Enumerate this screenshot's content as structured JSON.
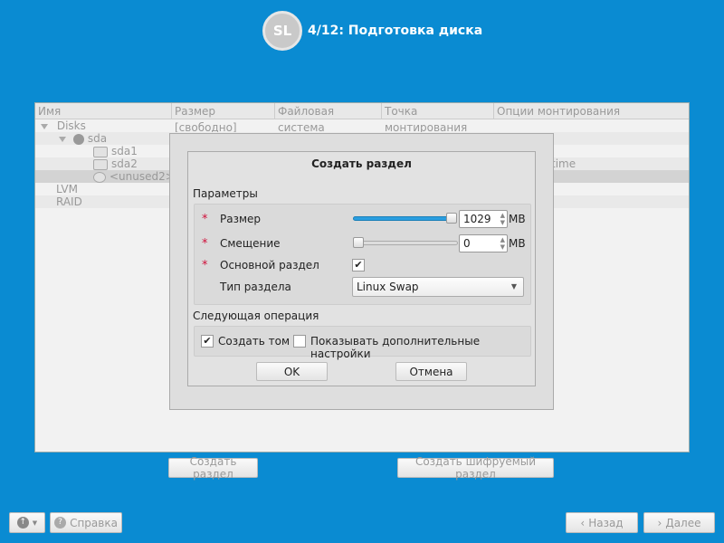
{
  "header": {
    "title": "4/12: Подготовка диска",
    "logo_text": "SL"
  },
  "table": {
    "columns": [
      "Имя",
      "Размер [свободно]",
      "Файловая система",
      "Точка монтирования",
      "Опции монтирования"
    ],
    "rows": {
      "disks": "Disks",
      "sda": "sda",
      "sda1": "sda1",
      "sda2": "sda2",
      "unused": "<unused2>",
      "lvm": "LVM",
      "raid": "RAID"
    },
    "partial_option": "time"
  },
  "actions": {
    "create_partition": "Создать раздел",
    "create_encrypted": "Создать шифруемый раздел"
  },
  "dialog": {
    "title": "Создать раздел",
    "params_label": "Параметры",
    "size_label": "Размер",
    "size_value": "1029",
    "size_unit": "MB",
    "size_slider_fraction": 1.0,
    "offset_label": "Смещение",
    "offset_value": "0",
    "offset_unit": "MB",
    "offset_slider_fraction": 0.0,
    "primary_label": "Основной раздел",
    "primary_checked": true,
    "type_label": "Тип раздела",
    "type_value": "Linux Swap",
    "next_label": "Следующая операция",
    "create_volume": "Создать том",
    "show_advanced": "Показывать дополнительные настройки",
    "ok": "OK",
    "cancel": "Отмена"
  },
  "footer": {
    "help": "Справка",
    "back": "Назад",
    "next": "Далее"
  },
  "colors": {
    "background": "#0a8bd2",
    "slider_fill": "#2a9ee0",
    "required": "#d0103a"
  }
}
